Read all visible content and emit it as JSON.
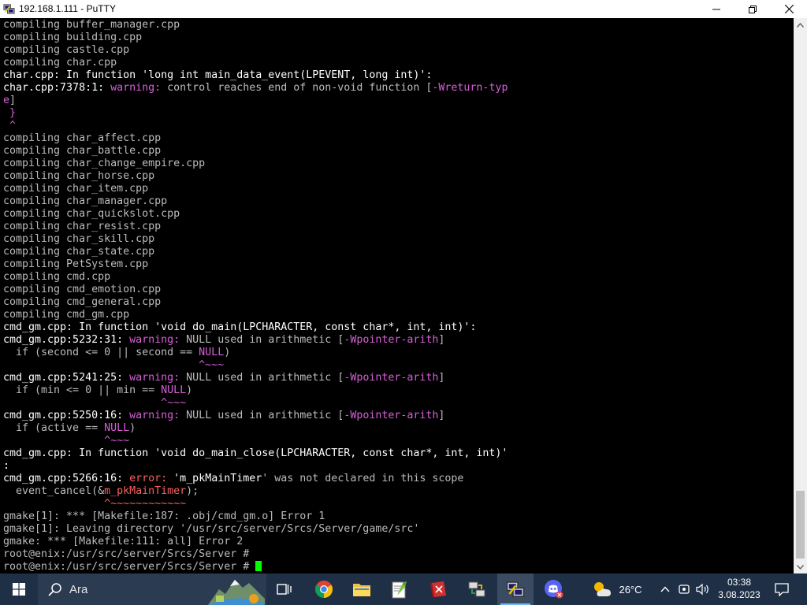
{
  "window": {
    "title": "192.168.1.111 - PuTTY"
  },
  "terminal": {
    "lines": [
      [
        {
          "t": "compiling buffer_manager.cpp"
        }
      ],
      [
        {
          "t": "compiling building.cpp"
        }
      ],
      [
        {
          "t": "compiling castle.cpp"
        }
      ],
      [
        {
          "t": "compiling char.cpp"
        }
      ],
      [
        {
          "t": "char.cpp: In function 'long int main_data_event(LPEVENT, long int)':",
          "c": "white"
        }
      ],
      [
        {
          "t": "char.cpp:7378:1: ",
          "c": "white"
        },
        {
          "t": "warning: ",
          "c": "warn"
        },
        {
          "t": "control reaches end of non-void function ["
        },
        {
          "t": "-Wreturn-typ",
          "c": "warn"
        }
      ],
      [
        {
          "t": "e",
          "c": "warn"
        },
        {
          "t": "]"
        }
      ],
      [
        {
          "t": " }",
          "c": "warn"
        }
      ],
      [
        {
          "t": " ^",
          "c": "warn"
        }
      ],
      [
        {
          "t": "compiling char_affect.cpp"
        }
      ],
      [
        {
          "t": "compiling char_battle.cpp"
        }
      ],
      [
        {
          "t": "compiling char_change_empire.cpp"
        }
      ],
      [
        {
          "t": "compiling char_horse.cpp"
        }
      ],
      [
        {
          "t": "compiling char_item.cpp"
        }
      ],
      [
        {
          "t": "compiling char_manager.cpp"
        }
      ],
      [
        {
          "t": "compiling char_quickslot.cpp"
        }
      ],
      [
        {
          "t": "compiling char_resist.cpp"
        }
      ],
      [
        {
          "t": "compiling char_skill.cpp"
        }
      ],
      [
        {
          "t": "compiling char_state.cpp"
        }
      ],
      [
        {
          "t": "compiling PetSystem.cpp"
        }
      ],
      [
        {
          "t": "compiling cmd.cpp"
        }
      ],
      [
        {
          "t": "compiling cmd_emotion.cpp"
        }
      ],
      [
        {
          "t": "compiling cmd_general.cpp"
        }
      ],
      [
        {
          "t": "compiling cmd_gm.cpp"
        }
      ],
      [
        {
          "t": "cmd_gm.cpp: In function 'void do_main(LPCHARACTER, const char*, int, int)':",
          "c": "white"
        }
      ],
      [
        {
          "t": "cmd_gm.cpp:5232:31: ",
          "c": "white"
        },
        {
          "t": "warning: ",
          "c": "warn"
        },
        {
          "t": "NULL used in arithmetic ["
        },
        {
          "t": "-Wpointer-arith",
          "c": "warn"
        },
        {
          "t": "]"
        }
      ],
      [
        {
          "t": "  if (second <= 0 || second == "
        },
        {
          "t": "NULL",
          "c": "warn"
        },
        {
          "t": ")"
        }
      ],
      [
        {
          "t": "                               ^~~~",
          "c": "warn"
        }
      ],
      [
        {
          "t": "cmd_gm.cpp:5241:25: ",
          "c": "white"
        },
        {
          "t": "warning: ",
          "c": "warn"
        },
        {
          "t": "NULL used in arithmetic ["
        },
        {
          "t": "-Wpointer-arith",
          "c": "warn"
        },
        {
          "t": "]"
        }
      ],
      [
        {
          "t": "  if (min <= 0 || min == "
        },
        {
          "t": "NULL",
          "c": "warn"
        },
        {
          "t": ")"
        }
      ],
      [
        {
          "t": "                         ^~~~",
          "c": "warn"
        }
      ],
      [
        {
          "t": "cmd_gm.cpp:5250:16: ",
          "c": "white"
        },
        {
          "t": "warning: ",
          "c": "warn"
        },
        {
          "t": "NULL used in arithmetic ["
        },
        {
          "t": "-Wpointer-arith",
          "c": "warn"
        },
        {
          "t": "]"
        }
      ],
      [
        {
          "t": "  if (active == "
        },
        {
          "t": "NULL",
          "c": "warn"
        },
        {
          "t": ")"
        }
      ],
      [
        {
          "t": "                ^~~~",
          "c": "warn"
        }
      ],
      [
        {
          "t": "cmd_gm.cpp: In function 'void do_main_close(LPCHARACTER, const char*, int, int)'",
          "c": "white"
        }
      ],
      [
        {
          "t": ":",
          "c": "white"
        }
      ],
      [
        {
          "t": "cmd_gm.cpp:5266:16: ",
          "c": "white"
        },
        {
          "t": "error: ",
          "c": "err"
        },
        {
          "t": "'",
          "c": "white"
        },
        {
          "t": "m_pkMainTimer",
          "c": "white"
        },
        {
          "t": "' was not declared in this scope"
        }
      ],
      [
        {
          "t": "  event_cancel(&"
        },
        {
          "t": "m_pkMainTimer",
          "c": "err"
        },
        {
          "t": ");"
        }
      ],
      [
        {
          "t": "                ^~~~~~~~~~~~~",
          "c": "err"
        }
      ],
      [
        {
          "t": "gmake[1]: *** [Makefile:187: .obj/cmd_gm.o] Error 1"
        }
      ],
      [
        {
          "t": "gmake[1]: Leaving directory '/usr/src/server/Srcs/Server/game/src'"
        }
      ],
      [
        {
          "t": "gmake: *** [Makefile:111: all] Error 2"
        }
      ],
      [
        {
          "t": "root@enix:/usr/src/server/Srcs/Server # "
        }
      ],
      [
        {
          "t": "root@enix:/usr/src/server/Srcs/Server # "
        },
        {
          "cursor": true
        }
      ]
    ]
  },
  "taskbar": {
    "search_placeholder": "Ara",
    "weather_temp": "26°C",
    "clock_time": "03:38",
    "clock_date": "3.08.2023"
  },
  "colors": {
    "terminal_bg": "#000000",
    "terminal_text": "#bbbbbb",
    "warning": "#d75fd7",
    "error": "#ff5f5f",
    "cursor": "#00ff00",
    "taskbar_bg": "#1f2f46"
  }
}
